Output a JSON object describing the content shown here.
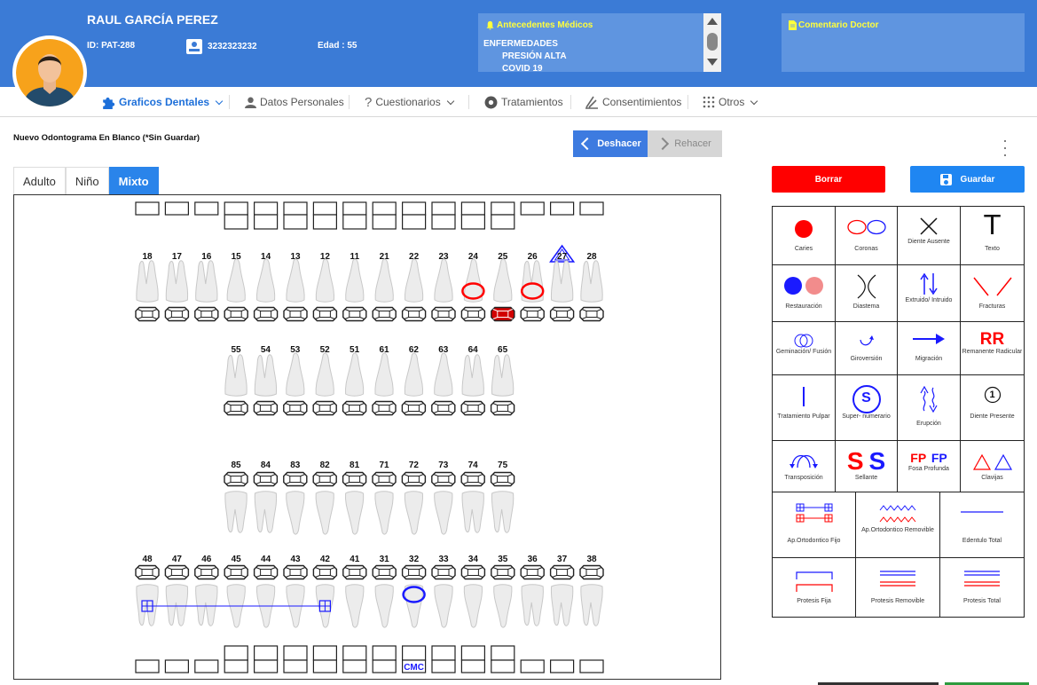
{
  "patient": {
    "name": "RAUL GARCÍA PEREZ",
    "id": "ID:  PAT-288",
    "phone": "3232323232",
    "age": "Edad : 55"
  },
  "antecedentes": {
    "title": "Antecedentes Médicos",
    "heading": "ENFERMEDADES",
    "items": [
      "PRESIÓN ALTA",
      "COVID 19"
    ]
  },
  "comentario": {
    "title": "Comentario Doctor"
  },
  "nav": {
    "items": [
      "Graficos Dentales",
      "Datos Personales",
      "Cuestionarios",
      "Tratamientos",
      "Consentimientos",
      "Otros"
    ]
  },
  "page": {
    "title": "Nuevo Odontograma En Blanco (*Sin Guardar)",
    "undo": "Deshacer",
    "redo": "Rehacer"
  },
  "tabs": [
    "Adulto",
    "Niño",
    "Mixto"
  ],
  "actions": {
    "delete": "Borrar",
    "save": "Guardar"
  },
  "odontogram": {
    "upper_permanent": [
      "18",
      "17",
      "16",
      "15",
      "14",
      "13",
      "12",
      "11",
      "21",
      "22",
      "23",
      "24",
      "25",
      "26",
      "27",
      "28"
    ],
    "upper_primary": [
      "55",
      "54",
      "53",
      "52",
      "51",
      "61",
      "62",
      "63",
      "64",
      "65"
    ],
    "lower_primary": [
      "85",
      "84",
      "83",
      "82",
      "81",
      "71",
      "72",
      "73",
      "74",
      "75"
    ],
    "lower_permanent": [
      "48",
      "47",
      "46",
      "45",
      "44",
      "43",
      "42",
      "41",
      "31",
      "32",
      "33",
      "34",
      "35",
      "36",
      "37",
      "38"
    ],
    "annotation_text": "CMC",
    "colors": {
      "red": "#ff0000",
      "blue": "#1a1aff",
      "dark_red": "#d10000"
    }
  },
  "palette": {
    "row1": [
      "Caries",
      "Coronas",
      "Diente Ausente",
      "Texto"
    ],
    "row2": [
      "Restauración",
      "Diastema",
      "Extruido/ Intruido",
      "Fracturas"
    ],
    "row3": [
      "Geminación/ Fusión",
      "Giroversión",
      "Migración",
      "Remanente Radicular"
    ],
    "row4": [
      "Tratamiento Pulpar",
      "Super- numerario",
      "Erupción",
      "Diente Presente"
    ],
    "row5": [
      "Transposición",
      "Sellante",
      "Fosa Profunda",
      "Clavijas"
    ],
    "row6": [
      "Ap.Ortodontico Fijo",
      "Ap.Ortodontico Removible",
      "Edentulo Total"
    ],
    "row7": [
      "Protesis Fija",
      "Protesis Removible",
      "Protesis Total"
    ],
    "glyphs": {
      "texto": "T",
      "remanente": "RR",
      "super": "S",
      "presente": "1",
      "sellante": "S",
      "fosa": "FP"
    }
  }
}
